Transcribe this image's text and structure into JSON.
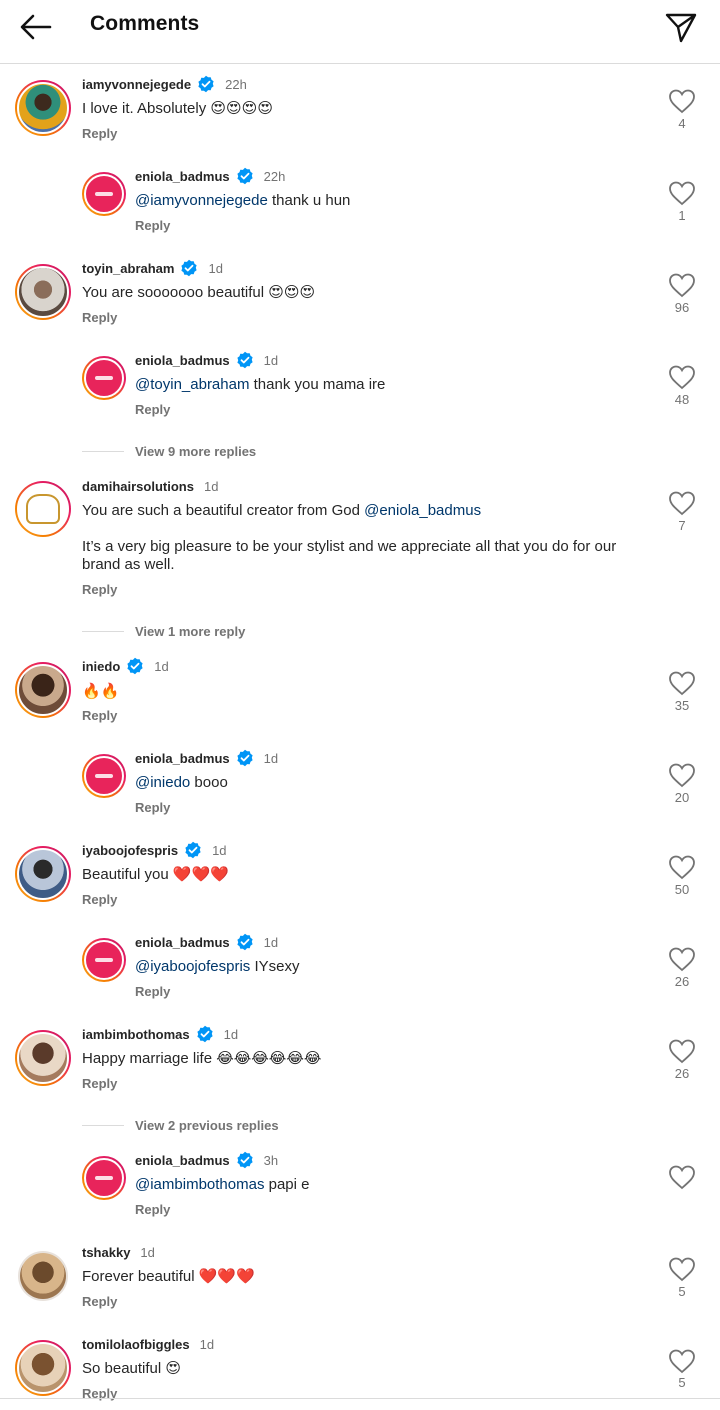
{
  "header": {
    "title": "Comments"
  },
  "comments": [
    {
      "user": "iamyvonnejegede",
      "verified": true,
      "time": "22h",
      "text": "I love it. Absolutely 😍😍😍😍",
      "likes": "4",
      "reply": "Reply"
    },
    {
      "user": "eniola_badmus",
      "verified": true,
      "time": "22h",
      "mention": "@iamyvonnejegede",
      "text": " thank u hun",
      "likes": "1",
      "reply": "Reply"
    },
    {
      "user": "toyin_abraham",
      "verified": true,
      "time": "1d",
      "text": "You are sooooooo beautiful 😍😍😍",
      "likes": "96",
      "reply": "Reply"
    },
    {
      "user": "eniola_badmus",
      "verified": true,
      "time": "1d",
      "mention": "@toyin_abraham",
      "text": " thank you mama ire",
      "likes": "48",
      "reply": "Reply"
    },
    {
      "view_more": "View 9 more replies"
    },
    {
      "user": "damihairsolutions",
      "verified": false,
      "time": "1d",
      "text": "You are such a beautiful creator from God ",
      "mention_after": "@eniola_badmus",
      "text2": "It’s a very big pleasure to be your stylist and we appreciate all that you do for our brand as well.",
      "likes": "7",
      "reply": "Reply"
    },
    {
      "view_more": "View 1 more reply"
    },
    {
      "user": "iniedo",
      "verified": true,
      "time": "1d",
      "text": "🔥🔥",
      "likes": "35",
      "reply": "Reply"
    },
    {
      "user": "eniola_badmus",
      "verified": true,
      "time": "1d",
      "mention": "@iniedo",
      "text": " booo",
      "likes": "20",
      "reply": "Reply"
    },
    {
      "user": "iyaboojofespris",
      "verified": true,
      "time": "1d",
      "text": "Beautiful you ❤️❤️❤️",
      "likes": "50",
      "reply": "Reply"
    },
    {
      "user": "eniola_badmus",
      "verified": true,
      "time": "1d",
      "mention": "@iyaboojofespris",
      "text": " IYsexy",
      "likes": "26",
      "reply": "Reply"
    },
    {
      "user": "iambimbothomas",
      "verified": true,
      "time": "1d",
      "text": "Happy marriage life 😂😂😂😂😂😂",
      "likes": "26",
      "reply": "Reply"
    },
    {
      "view_more": "View 2 previous replies"
    },
    {
      "user": "eniola_badmus",
      "verified": true,
      "time": "3h",
      "mention": "@iambimbothomas",
      "text": " papi e",
      "likes": "",
      "reply": "Reply"
    },
    {
      "user": "tshakky",
      "verified": false,
      "time": "1d",
      "text": "Forever beautiful ❤️❤️❤️",
      "likes": "5",
      "reply": "Reply"
    },
    {
      "user": "tomilolaofbiggles",
      "verified": false,
      "time": "1d",
      "text": "So beautiful 😍",
      "likes": "5",
      "reply": "Reply"
    }
  ],
  "icons": {
    "back": "arrow-left-icon",
    "send": "paper-plane-icon",
    "like": "heart-outline-icon",
    "verified": "verified-badge-icon"
  },
  "colors": {
    "verified": "#0095f6",
    "mention": "#00376b",
    "brand_avatar": "#e8245b"
  }
}
